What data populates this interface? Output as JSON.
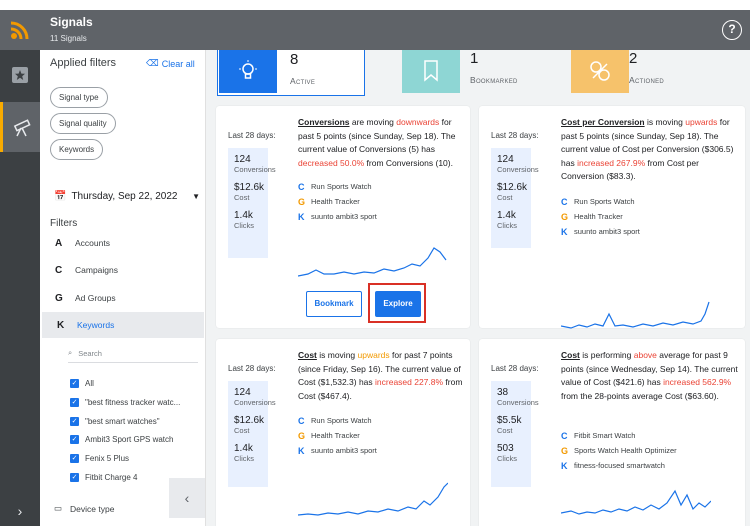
{
  "header": {
    "title": "Signals",
    "subtitle": "11 Signals",
    "help": "?"
  },
  "filters": {
    "applied_title": "Applied filters",
    "clear_all": "Clear all",
    "chips": [
      "Signal type",
      "Signal quality",
      "Keywords"
    ],
    "date": "Thursday, Sep 22, 2022",
    "section_title": "Filters",
    "items": [
      {
        "icon": "A",
        "label": "Accounts"
      },
      {
        "icon": "C",
        "label": "Campaigns"
      },
      {
        "icon": "G",
        "label": "Ad Groups"
      },
      {
        "icon": "K",
        "label": "Keywords"
      }
    ],
    "search_placeholder": "Search",
    "checkboxes": [
      "All",
      "\"best fitness tracker watc...",
      "\"best smart watches\"",
      "Ambit3 Sport GPS watch",
      "Fenix 5 Plus",
      "Fitbit Charge 4"
    ],
    "device_type": "Device type"
  },
  "tiles": [
    {
      "count": "8",
      "label": "Active"
    },
    {
      "count": "1",
      "label": "Bookmarked"
    },
    {
      "count": "2",
      "label": "Actioned"
    }
  ],
  "cards": [
    {
      "last28": "Last 28 days:",
      "metrics": [
        {
          "value": "124",
          "label": "Conversions"
        },
        {
          "value": "$12.6k",
          "label": "Cost"
        },
        {
          "value": "1.4k",
          "label": "Clicks"
        }
      ],
      "desc": {
        "metric": "Conversions",
        "p1": " are moving ",
        "hl1": "downwards",
        "p2": " for past 5 points (since Sunday, Sep 18). The current value of Conversions (5) has ",
        "hl2": "decreased 50.0%",
        "p3": " from Conversions (10)."
      },
      "entities": [
        {
          "icon": "C",
          "label": "Run Sports Watch"
        },
        {
          "icon": "G",
          "label": "Health Tracker"
        },
        {
          "icon": "K",
          "label": "suunto ambit3 sport"
        }
      ],
      "bookmark": "Bookmark",
      "explore": "Explore"
    },
    {
      "last28": "Last 28 days:",
      "metrics": [
        {
          "value": "124",
          "label": "Conversions"
        },
        {
          "value": "$12.6k",
          "label": "Cost"
        },
        {
          "value": "1.4k",
          "label": "Clicks"
        }
      ],
      "desc": {
        "metric": "Cost per Conversion",
        "p1": " is moving ",
        "hl1": "upwards",
        "p2": " for past 5 points (since Sunday, Sep 18). The current value of Cost per Conversion ($306.5) has ",
        "hl2": "increased 267.9%",
        "p3": " from Cost per Conversion ($83.3)."
      },
      "entities": [
        {
          "icon": "C",
          "label": "Run Sports Watch"
        },
        {
          "icon": "G",
          "label": "Health Tracker"
        },
        {
          "icon": "K",
          "label": "suunto ambit3 sport"
        }
      ]
    },
    {
      "last28": "Last 28 days:",
      "metrics": [
        {
          "value": "124",
          "label": "Conversions"
        },
        {
          "value": "$12.6k",
          "label": "Cost"
        },
        {
          "value": "1.4k",
          "label": "Clicks"
        }
      ],
      "desc": {
        "metric": "Cost",
        "p1": " is moving ",
        "hl1": "upwards",
        "p2": " for past 7 points (since Friday, Sep 16). The current value of Cost ($1,532.3) has ",
        "hl2": "increased 227.8%",
        "p3": " from Cost ($467.4)."
      },
      "entities": [
        {
          "icon": "C",
          "label": "Run Sports Watch"
        },
        {
          "icon": "G",
          "label": "Health Tracker"
        },
        {
          "icon": "K",
          "label": "suunto ambit3 sport"
        }
      ]
    },
    {
      "last28": "Last 28 days:",
      "metrics": [
        {
          "value": "38",
          "label": "Conversions"
        },
        {
          "value": "$5.5k",
          "label": "Cost"
        },
        {
          "value": "503",
          "label": "Clicks"
        }
      ],
      "desc": {
        "metric": "Cost",
        "p1": " is performing ",
        "hl1": "above",
        "p2": " average for past 9 points (since Wednesday, Sep 14). The current value of Cost ($421.6) has ",
        "hl2": "increased 562.9%",
        "p3": " from the 28-points average Cost ($63.60)."
      },
      "entities": [
        {
          "icon": "C",
          "label": "Fitbit Smart Watch"
        },
        {
          "icon": "G",
          "label": "Sports Watch Health Optimizer"
        },
        {
          "icon": "K",
          "label": "fitness-focused smartwatch"
        }
      ]
    }
  ],
  "colors": {
    "accent": "#1a73e8",
    "warning": "#ea4335",
    "orange": "#f29900",
    "rail": "#3c4043",
    "topbar": "#5f6368",
    "tile_active": "#1a73e8",
    "tile_bookmarked": "#8ed6d4",
    "tile_actioned": "#f6c26b"
  }
}
